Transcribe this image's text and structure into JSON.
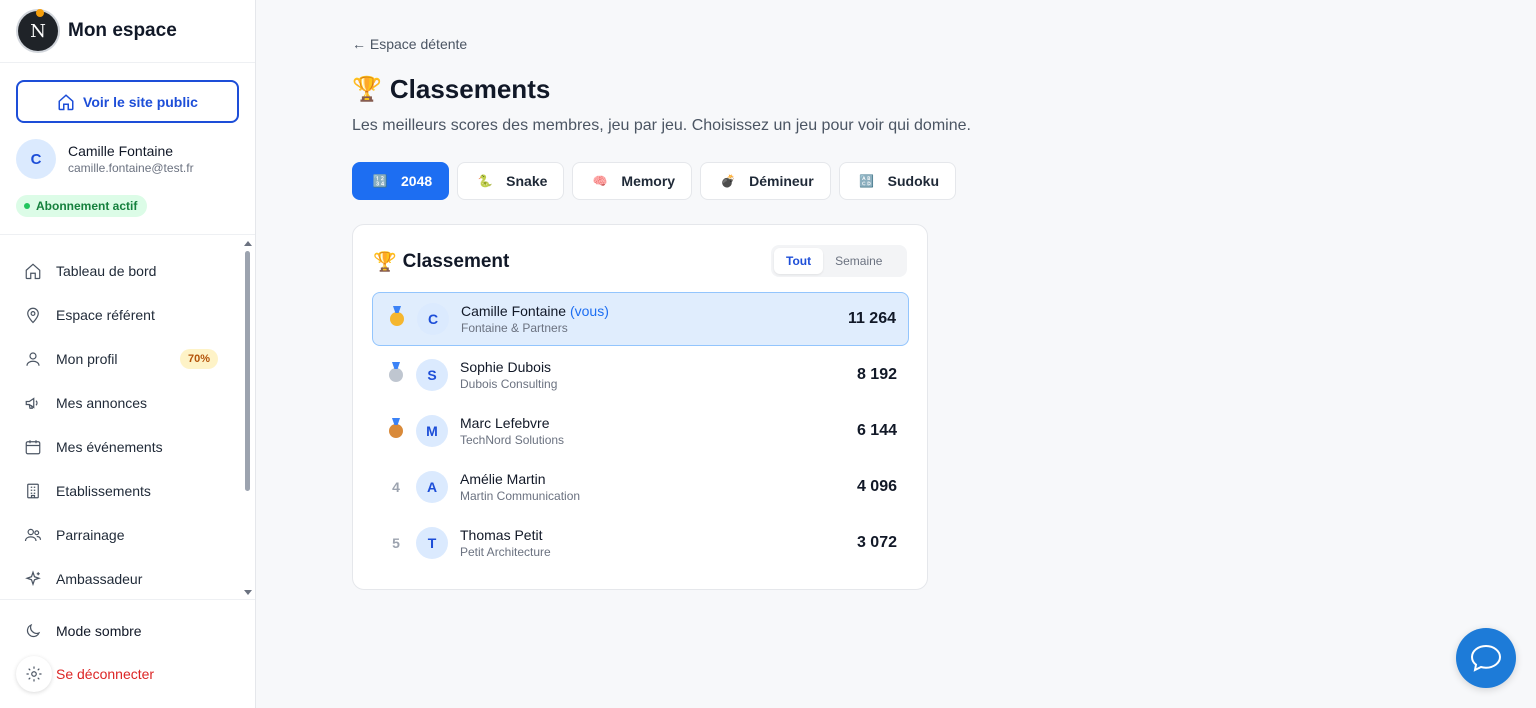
{
  "sidebar": {
    "brand": {
      "logo_letter": "N",
      "name": "Mon espace"
    },
    "public_button": "Voir le site public",
    "user": {
      "initial": "C",
      "name": "Camille Fontaine",
      "email": "camille.fontaine@test.fr"
    },
    "subscription_badge": "Abonnement actif",
    "nav_items": [
      {
        "label": "Tableau de bord",
        "icon": "home-icon"
      },
      {
        "label": "Espace référent",
        "icon": "location-pin-icon"
      },
      {
        "label": "Mon profil",
        "icon": "user-icon",
        "badge": "70%"
      },
      {
        "label": "Mes annonces",
        "icon": "megaphone-icon"
      },
      {
        "label": "Mes événements",
        "icon": "calendar-icon"
      },
      {
        "label": "Etablissements",
        "icon": "building-icon"
      },
      {
        "label": "Parrainage",
        "icon": "users-icon"
      },
      {
        "label": "Ambassadeur",
        "icon": "sparkle-icon"
      }
    ],
    "dark_mode": "Mode sombre",
    "logout": "Se déconnecter"
  },
  "main": {
    "back_link": "← Espace détente",
    "title_emoji": "🏆",
    "title": "Classements",
    "subtitle": "Les meilleurs scores des membres, jeu par jeu. Choisissez un jeu pour voir qui domine.",
    "game_tabs": [
      {
        "label": "2048",
        "emoji": "🔢",
        "active": true
      },
      {
        "label": "Snake",
        "emoji": "🐍",
        "active": false
      },
      {
        "label": "Memory",
        "emoji": "🧠",
        "active": false
      },
      {
        "label": "Démineur",
        "emoji": "💣",
        "active": false
      },
      {
        "label": "Sudoku",
        "emoji": "🔠",
        "active": false
      }
    ],
    "leaderboard": {
      "title_emoji": "🏆",
      "title": "Classement",
      "period_all": "Tout",
      "period_week": "Semaine",
      "rows": [
        {
          "rank": "1",
          "medal": "gold",
          "initial": "C",
          "name": "Camille Fontaine",
          "you": "(vous)",
          "company": "Fontaine & Partners",
          "score": "11 264",
          "highlight": true
        },
        {
          "rank": "2",
          "medal": "silver",
          "initial": "S",
          "name": "Sophie Dubois",
          "you": "",
          "company": "Dubois Consulting",
          "score": "8 192"
        },
        {
          "rank": "3",
          "medal": "bronze",
          "initial": "M",
          "name": "Marc Lefebvre",
          "you": "",
          "company": "TechNord Solutions",
          "score": "6 144"
        },
        {
          "rank": "4",
          "medal": "",
          "initial": "A",
          "name": "Amélie Martin",
          "you": "",
          "company": "Martin Communication",
          "score": "4 096"
        },
        {
          "rank": "5",
          "medal": "",
          "initial": "T",
          "name": "Thomas Petit",
          "you": "",
          "company": "Petit Architecture",
          "score": "3 072"
        }
      ]
    }
  },
  "colors": {
    "accent": "#1d6ef2",
    "danger": "#dc2626",
    "success": "#15803d"
  }
}
